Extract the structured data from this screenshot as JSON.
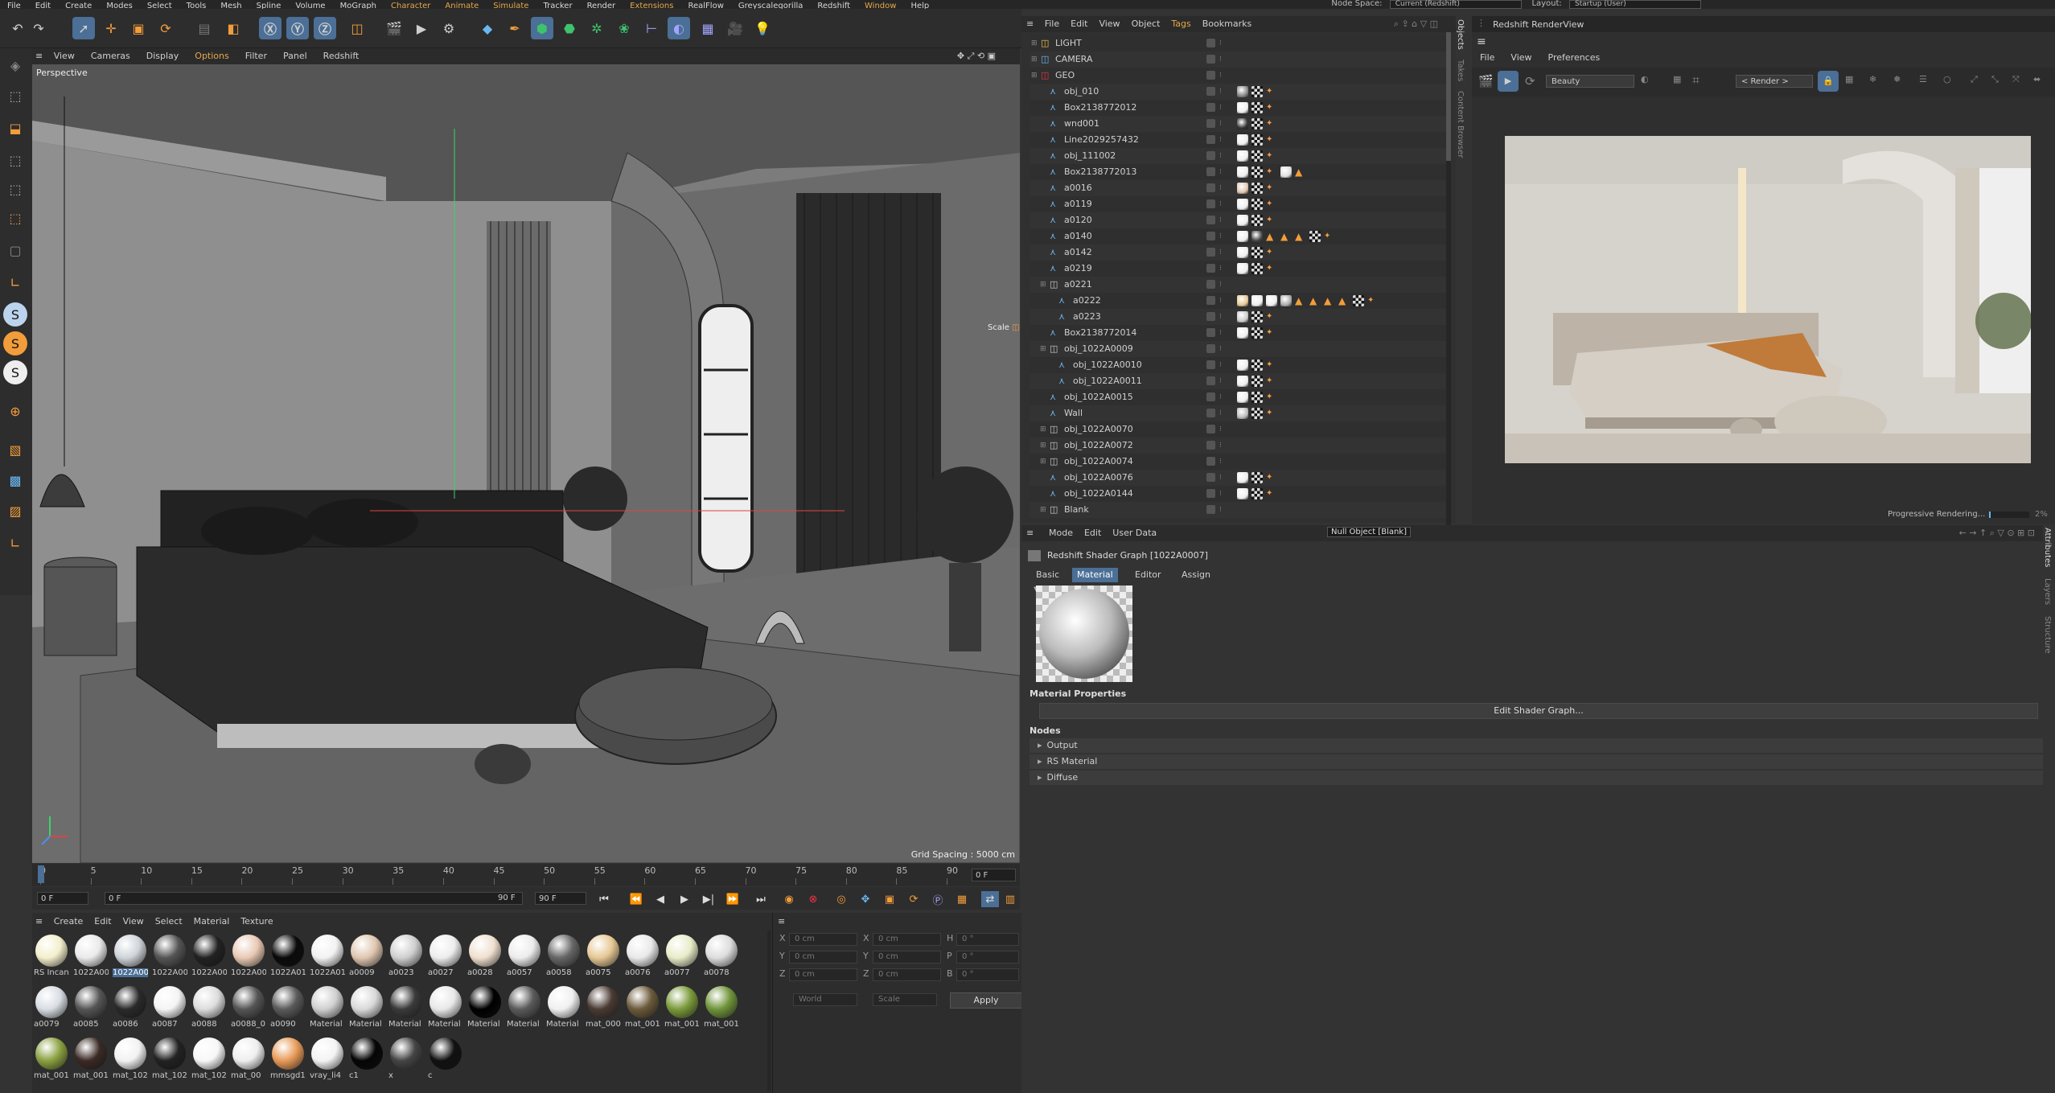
{
  "menubar": {
    "items": [
      "File",
      "Edit",
      "Create",
      "Modes",
      "Select",
      "Tools",
      "Mesh",
      "Spline",
      "Volume",
      "MoGraph",
      "Character",
      "Animate",
      "Simulate",
      "Tracker",
      "Render",
      "Extensions",
      "RealFlow",
      "Greyscalegorilla",
      "Redshift",
      "Window",
      "Help"
    ],
    "node_space_label": "Node Space:",
    "node_space_value": "Current (Redshift)",
    "layout_label": "Layout:",
    "layout_value": "Startup (User)"
  },
  "viewport": {
    "menu": [
      "View",
      "Cameras",
      "Display",
      "Options",
      "Filter",
      "Panel",
      "Redshift"
    ],
    "label": "Perspective",
    "grid_spacing": "Grid Spacing : 5000 cm",
    "scale_hint": "Scale"
  },
  "timeline": {
    "ticks": [
      "0",
      "5",
      "10",
      "15",
      "20",
      "25",
      "30",
      "35",
      "40",
      "45",
      "50",
      "55",
      "60",
      "65",
      "70",
      "75",
      "80",
      "85",
      "90"
    ],
    "current_frame": "0 F"
  },
  "transport": {
    "start": "0 F",
    "current": "0 F",
    "end_a": "90 F",
    "end_b": "90 F"
  },
  "material_manager": {
    "menu": [
      "Create",
      "Edit",
      "View",
      "Select",
      "Material",
      "Texture"
    ],
    "materials": [
      {
        "name": "RS Incan",
        "color": "#f3efcc"
      },
      {
        "name": "1022A00",
        "color": "#eaeaea"
      },
      {
        "name": "1022A00",
        "color": "#cfd4d9",
        "selected": true
      },
      {
        "name": "1022A00",
        "color": "#555"
      },
      {
        "name": "1022A00",
        "color": "#222"
      },
      {
        "name": "1022A00",
        "color": "#e9c9b4"
      },
      {
        "name": "1022A01",
        "color": "#0a0a0a"
      },
      {
        "name": "1022A01",
        "color": "#f2f2f2"
      },
      {
        "name": "a0009",
        "color": "#e0c6b0"
      },
      {
        "name": "a0023",
        "color": "#cfcfcf"
      },
      {
        "name": "a0027",
        "color": "#ededed"
      },
      {
        "name": "a0028",
        "color": "#f0e0d0"
      },
      {
        "name": "a0057",
        "color": "#ececec"
      },
      {
        "name": "a0058",
        "color": "#666"
      },
      {
        "name": "a0075",
        "color": "#e6c894"
      },
      {
        "name": "a0076",
        "color": "#e9e9e9"
      },
      {
        "name": "a0077",
        "color": "#e8ecc8"
      },
      {
        "name": "a0078",
        "color": "#ddd"
      },
      {
        "name": "a0079",
        "color": "#d8dde3"
      },
      {
        "name": "a0085",
        "color": "#555"
      },
      {
        "name": "a0086",
        "color": "#2a2a2a"
      },
      {
        "name": "a0087",
        "color": "#f4f4f4"
      },
      {
        "name": "a0088",
        "color": "#dcdcdc"
      },
      {
        "name": "a0088_0",
        "color": "#555"
      },
      {
        "name": "a0090",
        "color": "#5a5a5a"
      },
      {
        "name": "Material",
        "color": "#cfcfcf"
      },
      {
        "name": "Material",
        "color": "#d9d9d9"
      },
      {
        "name": "Material",
        "color": "#3a3a3a"
      },
      {
        "name": "Material",
        "color": "#e8e8e8"
      },
      {
        "name": "Material",
        "color": "#000"
      },
      {
        "name": "Material",
        "color": "#5a5a5a"
      },
      {
        "name": "Material",
        "color": "#f0f0f0"
      },
      {
        "name": "mat_000",
        "color": "#4a3a33"
      },
      {
        "name": "mat_001",
        "color": "#6b5a3a"
      },
      {
        "name": "mat_001",
        "color": "#7a9a3a"
      },
      {
        "name": "mat_001",
        "color": "#6f943a"
      },
      {
        "name": "mat_001",
        "color": "#8aa040"
      },
      {
        "name": "mat_001",
        "color": "#3a2a25"
      },
      {
        "name": "mat_102",
        "color": "#f2f2f2"
      },
      {
        "name": "mat_102",
        "color": "#222"
      },
      {
        "name": "mat_102",
        "color": "#f7f7f7"
      },
      {
        "name": "mat_00",
        "color": "#eeeeee"
      },
      {
        "name": "mmsgd1",
        "color": "#e89a58"
      },
      {
        "name": "vray_li4",
        "color": "#f3f3f3"
      },
      {
        "name": "c1",
        "color": "#050505"
      },
      {
        "name": "x",
        "color": "#444"
      },
      {
        "name": "c",
        "color": "#111"
      }
    ]
  },
  "coordinates": {
    "rows": [
      {
        "a": "X",
        "av": "0 cm",
        "b": "X",
        "bv": "0 cm",
        "c": "H",
        "cv": "0 °"
      },
      {
        "a": "Y",
        "av": "0 cm",
        "b": "Y",
        "bv": "0 cm",
        "c": "P",
        "cv": "0 °"
      },
      {
        "a": "Z",
        "av": "0 cm",
        "b": "Z",
        "bv": "0 cm",
        "c": "B",
        "cv": "0 °"
      }
    ],
    "mode_a": "World",
    "mode_b": "Scale",
    "apply": "Apply"
  },
  "object_manager": {
    "menu": [
      "File",
      "Edit",
      "View",
      "Object",
      "Tags",
      "Bookmarks"
    ],
    "side_tabs": [
      "Objects",
      "Takes",
      "Content Browser"
    ],
    "objects": [
      {
        "name": "LIGHT",
        "indent": 0,
        "type": "null",
        "tags": []
      },
      {
        "name": "CAMERA",
        "indent": 0,
        "type": "null",
        "tags": []
      },
      {
        "name": "GEO",
        "indent": 0,
        "type": "null",
        "tags": []
      },
      {
        "name": "obj_010",
        "indent": 1,
        "type": "bone",
        "tags": [
          "#888",
          "check",
          "tex"
        ]
      },
      {
        "name": "Box2138772012",
        "indent": 1,
        "type": "bone",
        "tags": [
          "#eee",
          "check",
          "tex"
        ]
      },
      {
        "name": "wnd001",
        "indent": 1,
        "type": "bone",
        "tags": [
          "#333",
          "check",
          "tex"
        ]
      },
      {
        "name": "Line2029257432",
        "indent": 1,
        "type": "bone",
        "tags": [
          "#eee",
          "check",
          "tex"
        ]
      },
      {
        "name": "obj_111002",
        "indent": 1,
        "type": "bone",
        "tags": [
          "#eee",
          "check",
          "tex"
        ]
      },
      {
        "name": "Box2138772013",
        "indent": 1,
        "type": "bone",
        "tags": [
          "#eee",
          "check",
          "tex",
          "#ddd",
          "tri"
        ]
      },
      {
        "name": "a0016",
        "indent": 1,
        "type": "bone",
        "tags": [
          "#e0c6b0",
          "check",
          "tex"
        ]
      },
      {
        "name": "a0119",
        "indent": 1,
        "type": "bone",
        "tags": [
          "#eee",
          "check",
          "tex"
        ]
      },
      {
        "name": "a0120",
        "indent": 1,
        "type": "bone",
        "tags": [
          "#eee",
          "check",
          "tex"
        ]
      },
      {
        "name": "a0140",
        "indent": 1,
        "type": "bone",
        "tags": [
          "#eee",
          "#444",
          "tri",
          "tri",
          "tri",
          "check",
          "tex"
        ]
      },
      {
        "name": "a0142",
        "indent": 1,
        "type": "bone",
        "tags": [
          "#eee",
          "check",
          "tex"
        ]
      },
      {
        "name": "a0219",
        "indent": 1,
        "type": "bone",
        "tags": [
          "#eee",
          "check",
          "tex"
        ]
      },
      {
        "name": "a0221",
        "indent": 1,
        "type": "null",
        "tags": []
      },
      {
        "name": "a0222",
        "indent": 2,
        "type": "bone",
        "tags": [
          "#e6c894",
          "#eee",
          "#eee",
          "#aaa",
          "tri",
          "tri",
          "tri",
          "tri",
          "check",
          "tex"
        ]
      },
      {
        "name": "a0223",
        "indent": 2,
        "type": "bone",
        "tags": [
          "#ccc",
          "check",
          "tex"
        ]
      },
      {
        "name": "Box2138772014",
        "indent": 1,
        "type": "bone",
        "tags": [
          "#eee",
          "check",
          "tex"
        ]
      },
      {
        "name": "obj_1022A0009",
        "indent": 1,
        "type": "null",
        "tags": []
      },
      {
        "name": "obj_1022A0010",
        "indent": 2,
        "type": "bone",
        "tags": [
          "#eee",
          "check",
          "tex"
        ]
      },
      {
        "name": "obj_1022A0011",
        "indent": 2,
        "type": "bone",
        "tags": [
          "#eee",
          "check",
          "tex"
        ]
      },
      {
        "name": "obj_1022A0015",
        "indent": 1,
        "type": "bone",
        "tags": [
          "#eee",
          "check",
          "tex"
        ]
      },
      {
        "name": "Wall",
        "indent": 1,
        "type": "bone",
        "tags": [
          "#bbb",
          "check",
          "tex"
        ]
      },
      {
        "name": "obj_1022A0070",
        "indent": 1,
        "type": "null",
        "tags": []
      },
      {
        "name": "obj_1022A0072",
        "indent": 1,
        "type": "null",
        "tags": []
      },
      {
        "name": "obj_1022A0074",
        "indent": 1,
        "type": "null",
        "tags": []
      },
      {
        "name": "obj_1022A0076",
        "indent": 1,
        "type": "bone",
        "tags": [
          "#eee",
          "check",
          "tex"
        ]
      },
      {
        "name": "obj_1022A0144",
        "indent": 1,
        "type": "bone",
        "tags": [
          "#eee",
          "check",
          "tex"
        ]
      },
      {
        "name": "Blank",
        "indent": 1,
        "type": "null",
        "tags": []
      }
    ]
  },
  "render_view": {
    "title": "Redshift RenderView",
    "menu": [
      "File",
      "View",
      "Preferences"
    ],
    "aov": "Beauty",
    "render_mode": "< Render >",
    "status": "Progressive Rendering...",
    "percent": "2%"
  },
  "attributes": {
    "menu": [
      "Mode",
      "Edit",
      "User Data"
    ],
    "null_object": "Null Object [Blank]",
    "header": "Redshift Shader Graph [1022A0007]",
    "tabs": [
      "Basic",
      "Material",
      "Editor",
      "Assign"
    ],
    "active_tab": "Material",
    "section_props": "Material Properties",
    "edit_button": "Edit Shader Graph...",
    "nodes_label": "Nodes",
    "nodes": [
      "Output",
      "RS Material",
      "Diffuse"
    ],
    "side_tabs": [
      "Attributes",
      "Layers",
      "Structure"
    ]
  }
}
